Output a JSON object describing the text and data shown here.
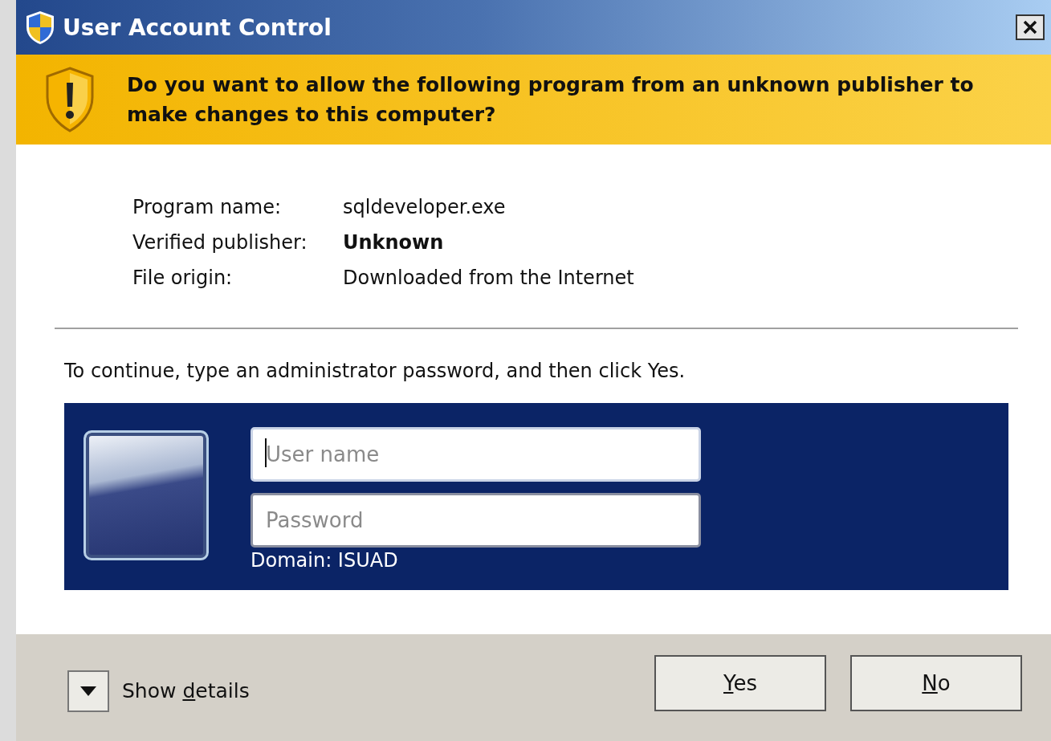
{
  "window": {
    "title": "User Account Control"
  },
  "banner": {
    "question": "Do you want to allow the following program from an unknown publisher to make changes to this computer?"
  },
  "details": [
    {
      "label": "Program name:",
      "value": "sqldeveloper.exe",
      "bold": false
    },
    {
      "label": "Verified publisher:",
      "value": "Unknown",
      "bold": true
    },
    {
      "label": "File origin:",
      "value": "Downloaded from the Internet",
      "bold": false
    }
  ],
  "instruction": "To continue, type an administrator password, and then click Yes.",
  "credentials": {
    "fields": [
      {
        "placeholder": "User name",
        "focused": true
      },
      {
        "placeholder": "Password",
        "focused": false
      }
    ],
    "domain": "Domain: ISUAD"
  },
  "footer": {
    "details_toggle": {
      "label": "Show details",
      "expanded": false
    },
    "buttons": [
      {
        "label": "Yes"
      },
      {
        "label": "No"
      }
    ]
  }
}
